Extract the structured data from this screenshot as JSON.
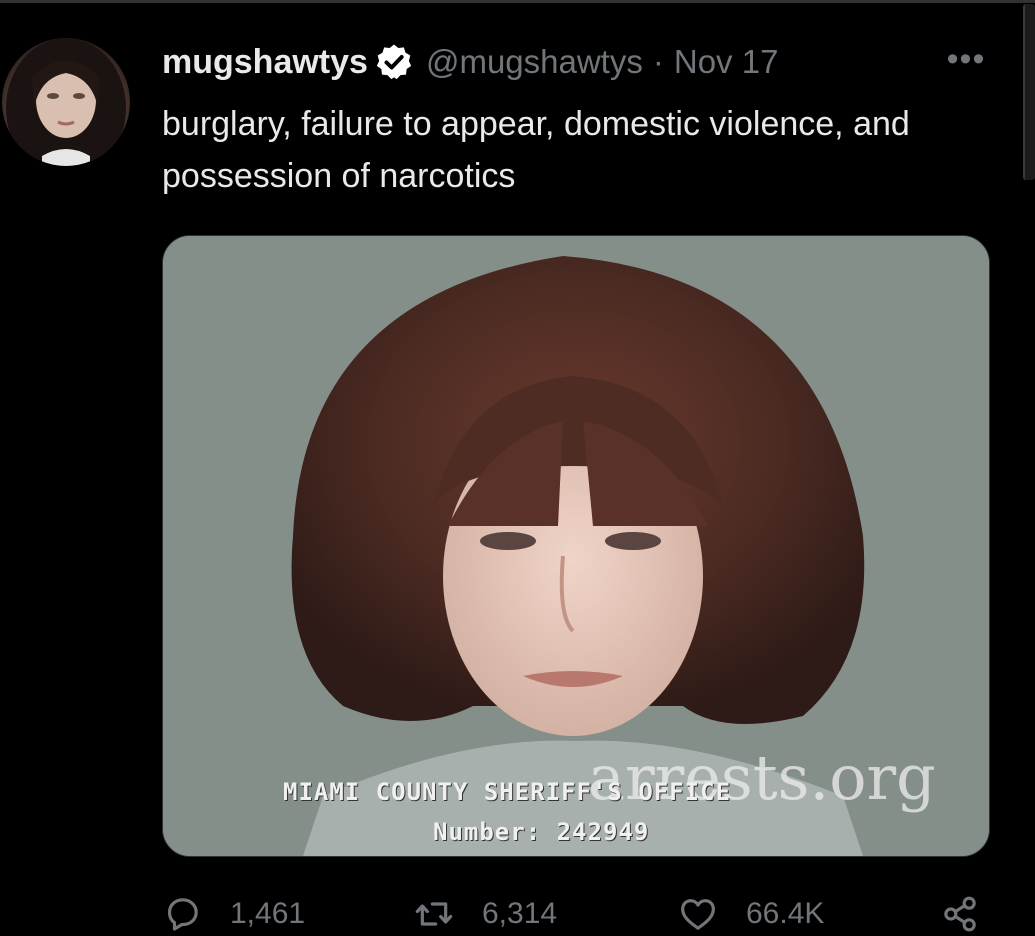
{
  "tweet": {
    "display_name": "mugshawtys",
    "handle": "@mugshawtys",
    "separator": "·",
    "date": "Nov 17",
    "more_label": "•••",
    "text": "burglary, failure to appear, domestic violence, and possession of narcotics",
    "verified_icon": "verified-badge-icon"
  },
  "media": {
    "caption_line1": "MIAMI COUNTY SHERIFF'S OFFICE",
    "caption_line2": "Number: 242949",
    "watermark": "arrests.org"
  },
  "actions": {
    "reply": {
      "icon": "reply-icon",
      "count": "1,461"
    },
    "retweet": {
      "icon": "retweet-icon",
      "count": "6,314"
    },
    "like": {
      "icon": "heart-icon",
      "count": "66.4K"
    },
    "share": {
      "icon": "share-icon"
    }
  },
  "colors": {
    "background": "#000000",
    "text_primary": "#e7e9ea",
    "text_secondary": "#71767b",
    "verified": "#ffffff"
  }
}
